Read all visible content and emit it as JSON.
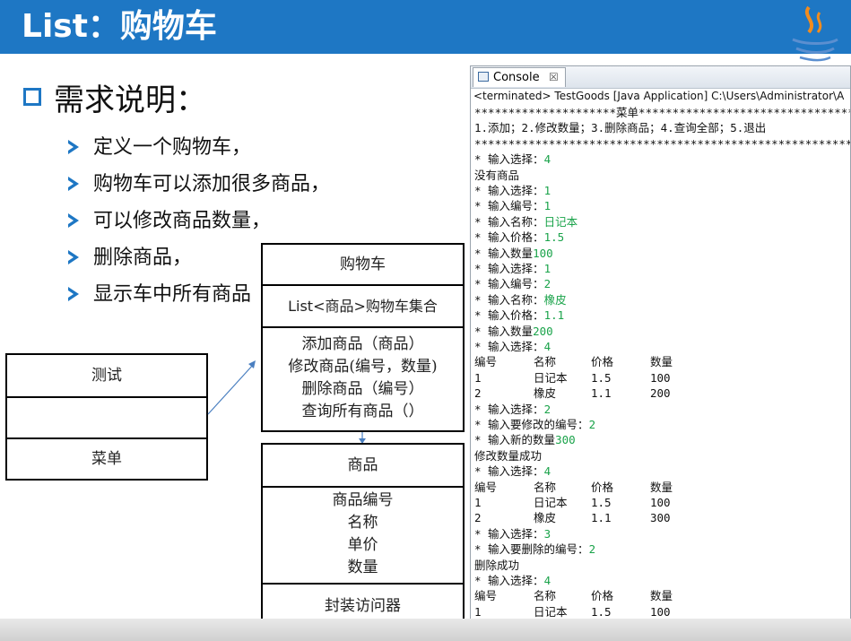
{
  "slide": {
    "title": "List：购物车",
    "requirement_heading": "需求说明：",
    "bullets": [
      "定义一个购物车，",
      "购物车可以添加很多商品，",
      "可以修改商品数量，",
      "删除商品，",
      "显示车中所有商品"
    ]
  },
  "diagram": {
    "cart": {
      "name": "购物车",
      "attribute": "List<商品>购物车集合",
      "methods": [
        "添加商品（商品）",
        "修改商品(编号，数量)",
        "删除商品（编号）",
        "查询所有商品（）"
      ]
    },
    "test": {
      "name": "测试",
      "middle": "",
      "bottom": "菜单"
    },
    "product": {
      "name": "商品",
      "attributes": [
        "商品编号",
        "名称",
        "单价",
        "数量"
      ],
      "bottom": "封装访问器"
    }
  },
  "console": {
    "tab_label": "Console",
    "close_glyph": "☒",
    "status": "<terminated> TestGoods [Java Application] C:\\Users\\Administrator\\A",
    "accent_color": "#1aa34a",
    "lines": [
      {
        "t": "*********************菜单***********************************"
      },
      {
        "t": "  1.添加；2.修改数量；3.删除商品；4.查询全部；5.退出"
      },
      {
        "t": "***********************************************************"
      },
      {
        "t": "* 输入选择：",
        "v": "4"
      },
      {
        "t": "没有商品"
      },
      {
        "t": "* 输入选择：",
        "v": "1"
      },
      {
        "t": "* 输入编号：",
        "v": "1"
      },
      {
        "t": "* 输入名称：",
        "v": "日记本"
      },
      {
        "t": "* 输入价格：",
        "v": "1.5"
      },
      {
        "t": "* 输入数量",
        "v": "100"
      },
      {
        "t": "* 输入选择：",
        "v": "1"
      },
      {
        "t": "* 输入编号：",
        "v": "2"
      },
      {
        "t": "* 输入名称：",
        "v": "橡皮"
      },
      {
        "t": "* 输入价格：",
        "v": "1.1"
      },
      {
        "t": "* 输入数量",
        "v": "200"
      },
      {
        "t": "* 输入选择：",
        "v": "4"
      },
      {
        "cols": [
          "编号",
          "名称",
          "价格",
          "数量"
        ]
      },
      {
        "cols": [
          "1",
          "日记本",
          "1.5",
          "100"
        ]
      },
      {
        "cols": [
          "2",
          "橡皮",
          "1.1",
          "200"
        ]
      },
      {
        "t": "* 输入选择：",
        "v": "2"
      },
      {
        "t": "* 输入要修改的编号：",
        "v": "2"
      },
      {
        "t": "* 输入新的数量",
        "v": "300"
      },
      {
        "t": "修改数量成功"
      },
      {
        "t": "* 输入选择：",
        "v": "4"
      },
      {
        "cols": [
          "编号",
          "名称",
          "价格",
          "数量"
        ]
      },
      {
        "cols": [
          "1",
          "日记本",
          "1.5",
          "100"
        ]
      },
      {
        "cols": [
          "2",
          "橡皮",
          "1.1",
          "300"
        ]
      },
      {
        "t": "* 输入选择：",
        "v": "3"
      },
      {
        "t": "* 输入要删除的编号：",
        "v": "2"
      },
      {
        "t": "删除成功"
      },
      {
        "t": "* 输入选择：",
        "v": "4"
      },
      {
        "cols": [
          "编号",
          "名称",
          "价格",
          "数量"
        ]
      },
      {
        "cols": [
          "1",
          "日记本",
          "1.5",
          "100"
        ]
      }
    ]
  }
}
